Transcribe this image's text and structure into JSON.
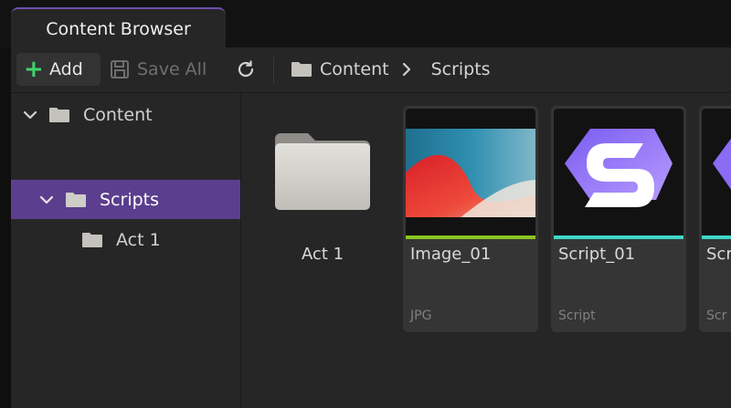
{
  "tab": {
    "title": "Content Browser"
  },
  "toolbar": {
    "add_label": "Add",
    "save_all_label": "Save All",
    "breadcrumb": [
      "Content",
      "Scripts"
    ]
  },
  "tree": {
    "items": [
      {
        "label": "Content",
        "level": 0,
        "expanded": true,
        "selected": false
      },
      {
        "label": "Scripts",
        "level": 1,
        "expanded": true,
        "selected": true
      },
      {
        "label": "Act 1",
        "level": 2,
        "expanded": false,
        "selected": false
      }
    ]
  },
  "assets": [
    {
      "name": "Act 1",
      "kind": "folder",
      "icon": "folder-icon"
    },
    {
      "name": "Image_01",
      "type": "JPG",
      "kind": "image",
      "accent": "#8bc31f"
    },
    {
      "name": "Script_01",
      "type": "Script",
      "kind": "script",
      "accent": "#3fd6c8"
    },
    {
      "name": "Scr",
      "type": "Scr",
      "kind": "script",
      "accent": "#3fd6c8"
    }
  ],
  "colors": {
    "selection": "#5b3e8e",
    "add_icon": "#3ed36a",
    "image_accent": "#8bc31f",
    "script_accent": "#3fd6c8"
  }
}
